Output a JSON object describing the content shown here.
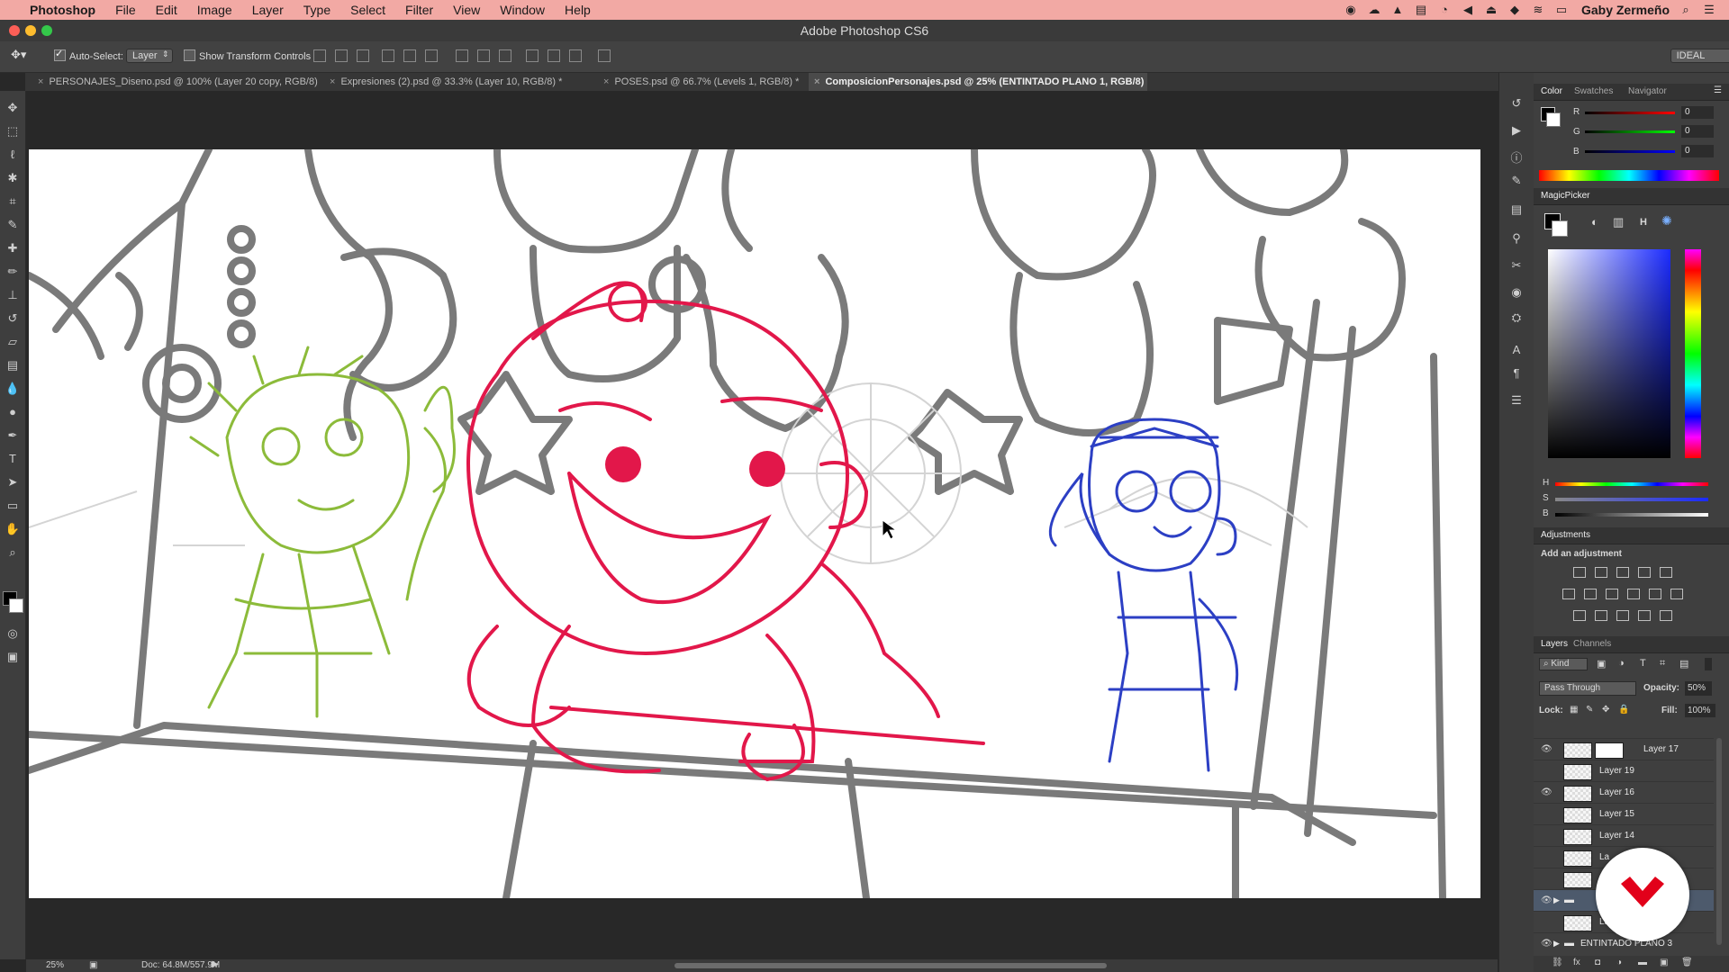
{
  "menubar": {
    "apple": "",
    "items": [
      "Photoshop",
      "File",
      "Edit",
      "Image",
      "Layer",
      "Type",
      "Select",
      "Filter",
      "View",
      "Window",
      "Help"
    ],
    "user": "Gaby Zermeño"
  },
  "window": {
    "title": "Adobe Photoshop CS6"
  },
  "options": {
    "auto_select_label": "Auto-Select:",
    "auto_select_value": "Layer",
    "transform_label": "Show Transform Controls",
    "workspace": "IDEAL"
  },
  "tabs": [
    "PERSONAJES_Diseno.psd @ 100% (Layer 20 copy, RGB/8)",
    "Expresiones (2).psd @ 33.3% (Layer 10, RGB/8) *",
    "POSES.psd @ 66.7% (Levels 1, RGB/8) *",
    "ComposicionPersonajes.psd @ 25% (ENTINTADO PLANO 1, RGB/8)"
  ],
  "status": {
    "zoom": "25%",
    "doc": "Doc: 64.8M/557.9M"
  },
  "color_panel": {
    "tabs": [
      "Color",
      "Swatches",
      "Navigator"
    ],
    "r_label": "R",
    "g_label": "G",
    "b_label": "B",
    "r": "0",
    "g": "0",
    "b": "0"
  },
  "magic_picker": {
    "title": "MagicPicker",
    "h": "H",
    "s": "S",
    "b": "B",
    "mode": "H"
  },
  "adjustments": {
    "title": "Adjustments",
    "hint": "Add an adjustment"
  },
  "layers_panel": {
    "tabs": [
      "Layers",
      "Channels"
    ],
    "kind": "Kind",
    "blend": "Pass Through",
    "opacity_label": "Opacity:",
    "opacity": "50%",
    "lock_label": "Lock:",
    "fill_label": "Fill:",
    "fill": "100%",
    "layers": [
      {
        "name": "Layer 17",
        "visible": true
      },
      {
        "name": "Layer 19",
        "visible": false
      },
      {
        "name": "Layer 16",
        "visible": true
      },
      {
        "name": "Layer 15",
        "visible": false
      },
      {
        "name": "Layer 14",
        "visible": false
      },
      {
        "name": "La",
        "visible": false
      },
      {
        "name": "La",
        "visible": false
      },
      {
        "name": "",
        "visible": true
      },
      {
        "name": "La",
        "visible": false
      },
      {
        "name": "ENTINTADO PLANO 3",
        "visible": true
      }
    ]
  },
  "colors": {
    "green_character": "#8cbb3a",
    "red_character": "#e2174a",
    "blue_character": "#2c3fc4",
    "logo": "#e2001a"
  }
}
